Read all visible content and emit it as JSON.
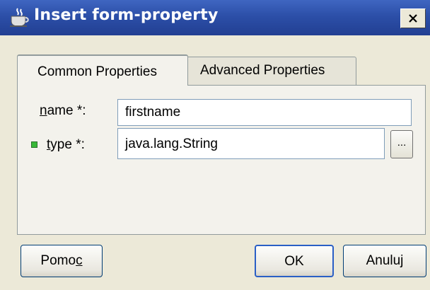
{
  "window": {
    "title": "Insert form-property"
  },
  "tabs": [
    {
      "label": "Common Properties",
      "active": true
    },
    {
      "label": "Advanced Properties",
      "active": false
    }
  ],
  "form": {
    "name": {
      "mnemonic": "n",
      "label_rest": "ame *:",
      "value": "firstname"
    },
    "type": {
      "mnemonic": "t",
      "label_rest": "ype *:",
      "value": "java.lang.String",
      "browse_label": "..."
    }
  },
  "buttons": {
    "help_prefix": "Pomo",
    "help_mnemonic": "c",
    "ok": "OK",
    "cancel": "Anuluj"
  },
  "colors": {
    "titlebar": "#2c4fa8",
    "dialog_bg": "#ece9d8",
    "indicator": "#38b838"
  }
}
